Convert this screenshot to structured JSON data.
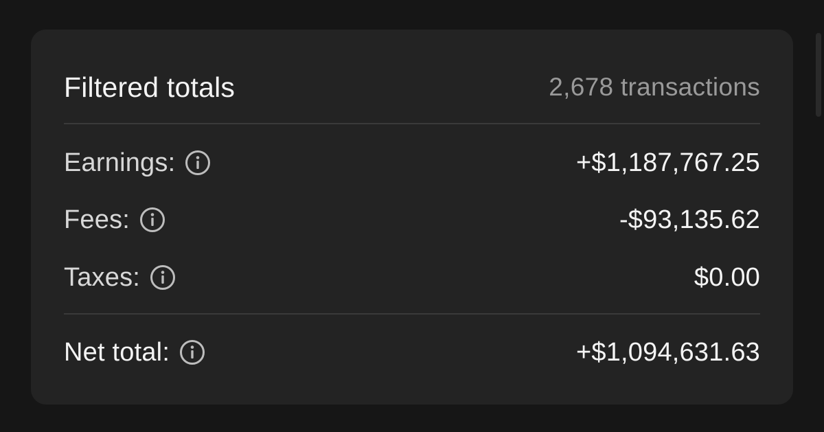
{
  "header": {
    "title": "Filtered totals",
    "transaction_count": "2,678 transactions"
  },
  "rows": [
    {
      "label": "Earnings:",
      "value": "+$1,187,767.25",
      "icon": "info-icon"
    },
    {
      "label": "Fees:",
      "value": "-$93,135.62",
      "icon": "info-icon"
    },
    {
      "label": "Taxes:",
      "value": "$0.00",
      "icon": "info-icon"
    }
  ],
  "net_total": {
    "label": "Net total:",
    "value": "+$1,094,631.63",
    "icon": "info-icon"
  },
  "colors": {
    "page_background": "#161616",
    "card_background": "#232323",
    "text_primary": "#f4f4f4",
    "text_secondary": "#9a9a9a",
    "divider": "#3a3a3a"
  }
}
